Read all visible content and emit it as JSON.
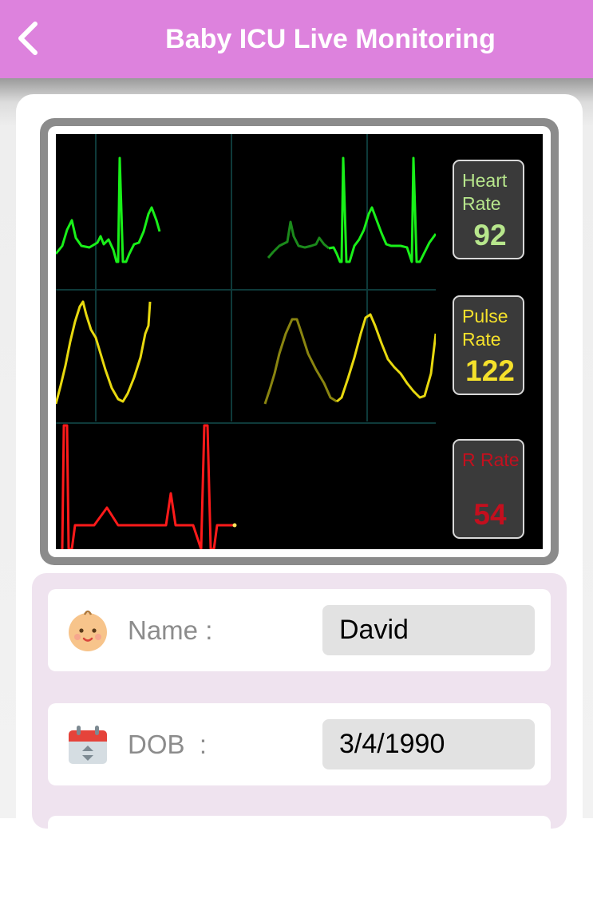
{
  "header": {
    "title": "Baby ICU Live Monitoring",
    "back_icon": "chevron-left-icon",
    "background": "#dd82dd"
  },
  "monitor": {
    "vitals": [
      {
        "label": "Heart Rate",
        "value": "92",
        "color": "#b7e68c"
      },
      {
        "label": "Pulse Rate",
        "value": "122",
        "color": "#f5e12b"
      },
      {
        "label": "R Rate",
        "value": "54",
        "color": "#c40f1e"
      }
    ],
    "trace_colors": {
      "ecg": "#19f019",
      "pleth": "#e8d90f",
      "resp": "#ff1a1a"
    }
  },
  "patient": {
    "name_label": "Name :",
    "name_value": "David",
    "name_icon": "baby-face-icon",
    "dob_label": "DOB  :",
    "dob_value": "3/4/1990",
    "dob_icon": "calendar-icon"
  }
}
